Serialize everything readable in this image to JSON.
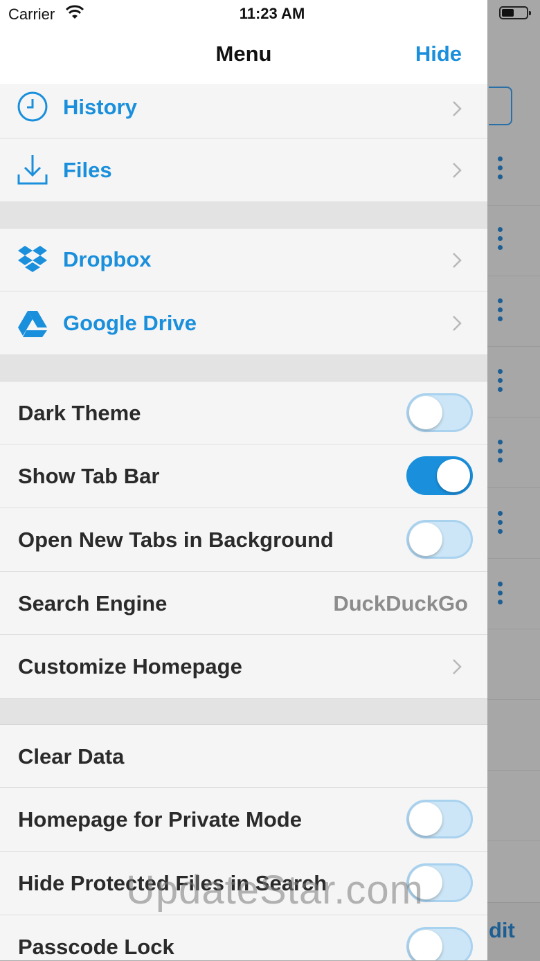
{
  "status_bar": {
    "carrier": "Carrier",
    "time": "11:23 AM"
  },
  "nav": {
    "title": "Menu",
    "hide_label": "Hide"
  },
  "section1": [
    {
      "label": "History",
      "icon": "clock-icon"
    },
    {
      "label": "Files",
      "icon": "download-icon"
    }
  ],
  "section2": [
    {
      "label": "Dropbox",
      "icon": "dropbox-icon"
    },
    {
      "label": "Google Drive",
      "icon": "google-drive-icon"
    }
  ],
  "section3": {
    "dark_theme": {
      "label": "Dark Theme",
      "on": false
    },
    "show_tab_bar": {
      "label": "Show Tab Bar",
      "on": true
    },
    "open_background": {
      "label": "Open New Tabs in Background",
      "on": false
    },
    "search_engine": {
      "label": "Search Engine",
      "value": "DuckDuckGo"
    },
    "customize_homepage": {
      "label": "Customize Homepage"
    }
  },
  "section4": {
    "clear_data": {
      "label": "Clear Data"
    },
    "homepage_private": {
      "label": "Homepage for Private Mode",
      "on": false
    },
    "hide_protected": {
      "label": "Hide Protected Files in Search",
      "on": false
    },
    "passcode_lock": {
      "label": "Passcode Lock",
      "on": false
    }
  },
  "background": {
    "edit_label": "dit"
  },
  "watermark": "UpdateStar.com",
  "colors": {
    "accent": "#1a8fdc",
    "toggle_off": "#cce6f7",
    "panel_bg": "#f5f5f5"
  }
}
